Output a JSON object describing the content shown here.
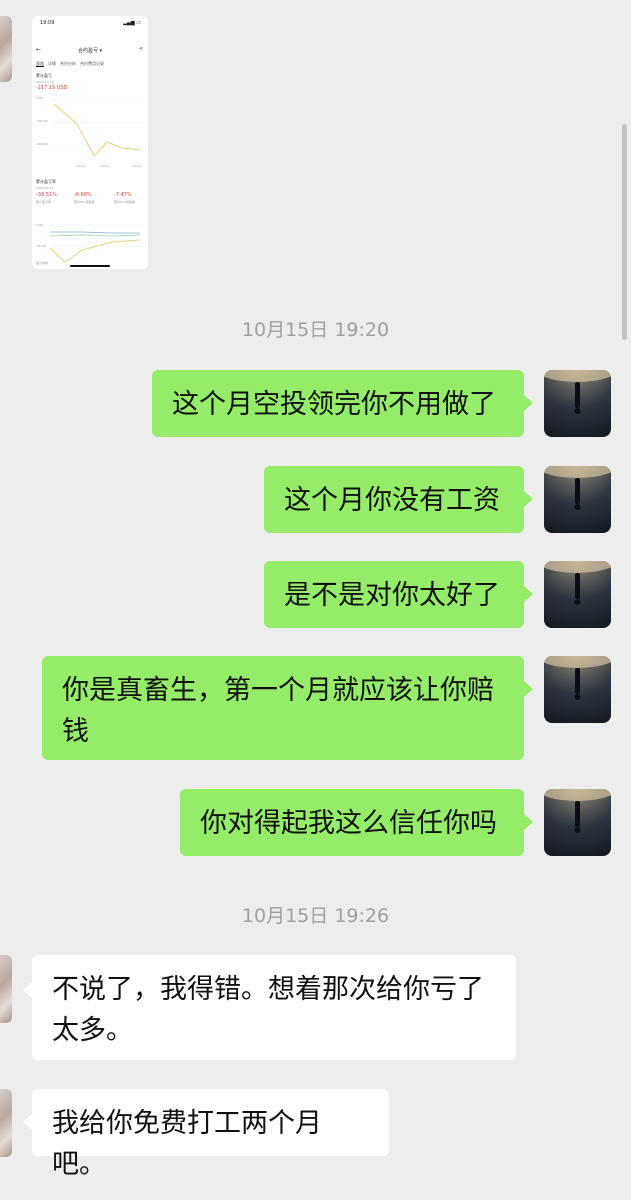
{
  "embedded_screenshot": {
    "status_time": "19:09",
    "status_icons": "▂▄▆ ▭",
    "header_title": "合约盈亏",
    "tabs": [
      "总览",
      "详情",
      "合约分析",
      "合约费用记录"
    ],
    "cumulative_pnl_label": "累计盈亏",
    "cumulative_pnl_date": "2023-10-14",
    "cumulative_pnl_value": "-217.15 USD",
    "chart1_ticks": [
      "0.00",
      "-100.00",
      "-200.00"
    ],
    "chart1_dates": [
      "10-10",
      "10-12",
      "10-14"
    ],
    "cumulative_rate_label": "累计盈亏率",
    "cumulative_rate_date": "2023-10-14",
    "rate_values": [
      "-38.51%",
      "-8.68%",
      "-7.47%"
    ],
    "rate_legend": [
      "累计盈亏率",
      "累计BTC涨跌幅",
      "累计ETH涨跌幅"
    ],
    "chart2_ticks": [
      "0.00",
      "-20.00"
    ],
    "chart2_dates": [
      "10-10",
      "10-12",
      "10-14"
    ],
    "footer_text": "盈亏构成"
  },
  "conversation": [
    {
      "kind": "timestamp",
      "text": "10月15日 19:20"
    },
    {
      "kind": "sent",
      "text": "这个月空投领完你不用做了"
    },
    {
      "kind": "sent",
      "text": "这个月你没有工资"
    },
    {
      "kind": "sent",
      "text": "是不是对你太好了"
    },
    {
      "kind": "sent",
      "text": "你是真畜生，第一个月就应该让你赔钱"
    },
    {
      "kind": "sent",
      "text": "你对得起我这么信任你吗"
    },
    {
      "kind": "timestamp",
      "text": "10月15日 19:26"
    },
    {
      "kind": "received",
      "text": "不说了，我得错。想着那次给你亏了太多。"
    },
    {
      "kind": "received",
      "text": "我给你免费打工两个月吧。"
    }
  ],
  "colors": {
    "background": "#ededed",
    "sent_bubble": "#95ec69",
    "received_bubble": "#ffffff",
    "timestamp_text": "#a0a0a0",
    "loss_red": "#e0463f"
  }
}
